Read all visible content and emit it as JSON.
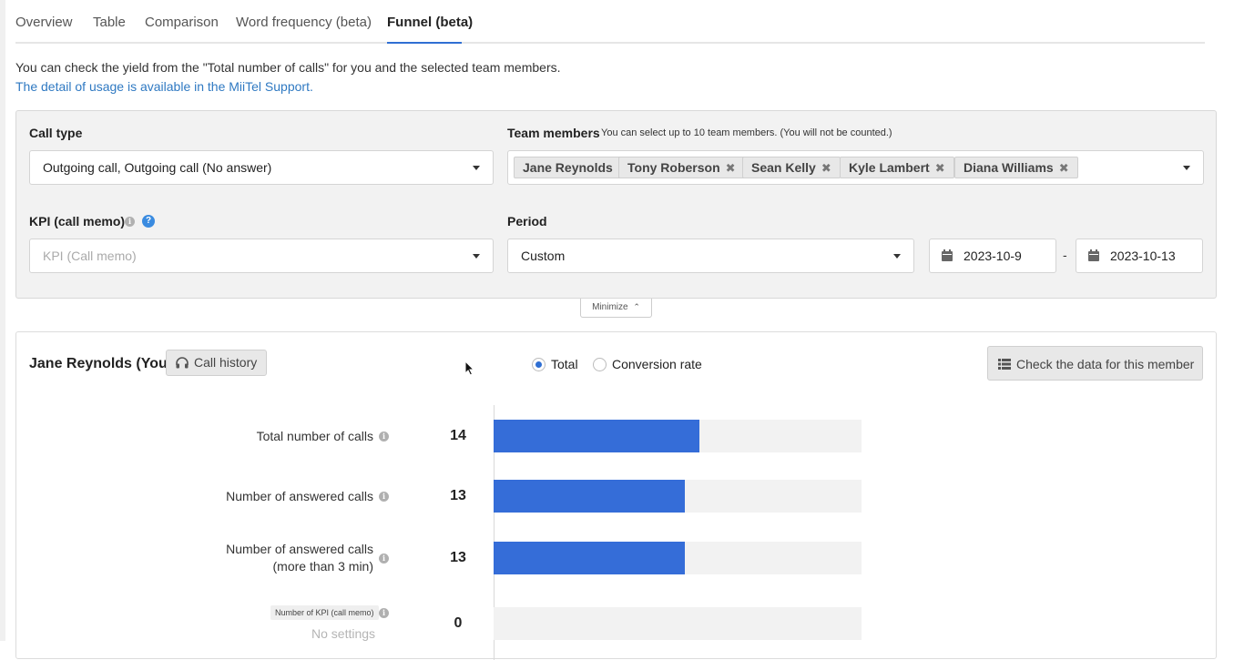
{
  "tabs": [
    {
      "label": "Overview"
    },
    {
      "label": "Table"
    },
    {
      "label": "Comparison"
    },
    {
      "label": "Word frequency (beta)"
    },
    {
      "label": "Funnel (beta)",
      "active": true
    }
  ],
  "intro": {
    "text": "You can check the yield from the \"Total number of calls\" for you and the selected team members.",
    "link": "The detail of usage is available in the MiiTel Support."
  },
  "filters": {
    "call_type": {
      "label": "Call type",
      "value": "Outgoing call, Outgoing call (No answer)"
    },
    "team_members": {
      "label": "Team members",
      "note": "You can select up to 10 team members. (You will not be counted.)",
      "chips": [
        {
          "name": "Jane Reynolds",
          "removable": false
        },
        {
          "name": "Tony Roberson",
          "removable": true
        },
        {
          "name": "Sean Kelly",
          "removable": true
        },
        {
          "name": "Kyle Lambert",
          "removable": true
        },
        {
          "name": "Diana Williams",
          "removable": true
        }
      ],
      "remove_glyph": "✖"
    },
    "kpi": {
      "label": "KPI (call memo)",
      "placeholder": "KPI (Call memo)"
    },
    "period": {
      "label": "Period",
      "value": "Custom",
      "start": "2023-10-9",
      "end": "2023-10-13",
      "separator": "-"
    }
  },
  "minimize": {
    "label": "Minimize"
  },
  "result": {
    "member": "Jane Reynolds (You)",
    "call_history_label": "Call history",
    "view_options": [
      {
        "label": "Total",
        "selected": true
      },
      {
        "label": "Conversion rate",
        "selected": false
      }
    ],
    "check_data_label": "Check the data for this member",
    "rows": [
      {
        "label": "Total number of calls",
        "value": "14",
        "fill": 0.56
      },
      {
        "label": "Number of answered calls",
        "value": "13",
        "fill": 0.52
      },
      {
        "label_line1": "Number of answered calls",
        "label_line2": "(more than 3 min)",
        "value": "13",
        "fill": 0.52
      },
      {
        "tag": "Number of KPI (call memo)",
        "sub": "No settings",
        "value": "0",
        "fill": 0
      }
    ]
  },
  "colors": {
    "accent": "#2f6fd3",
    "bar": "#356dd8",
    "link": "#2f79c2"
  }
}
